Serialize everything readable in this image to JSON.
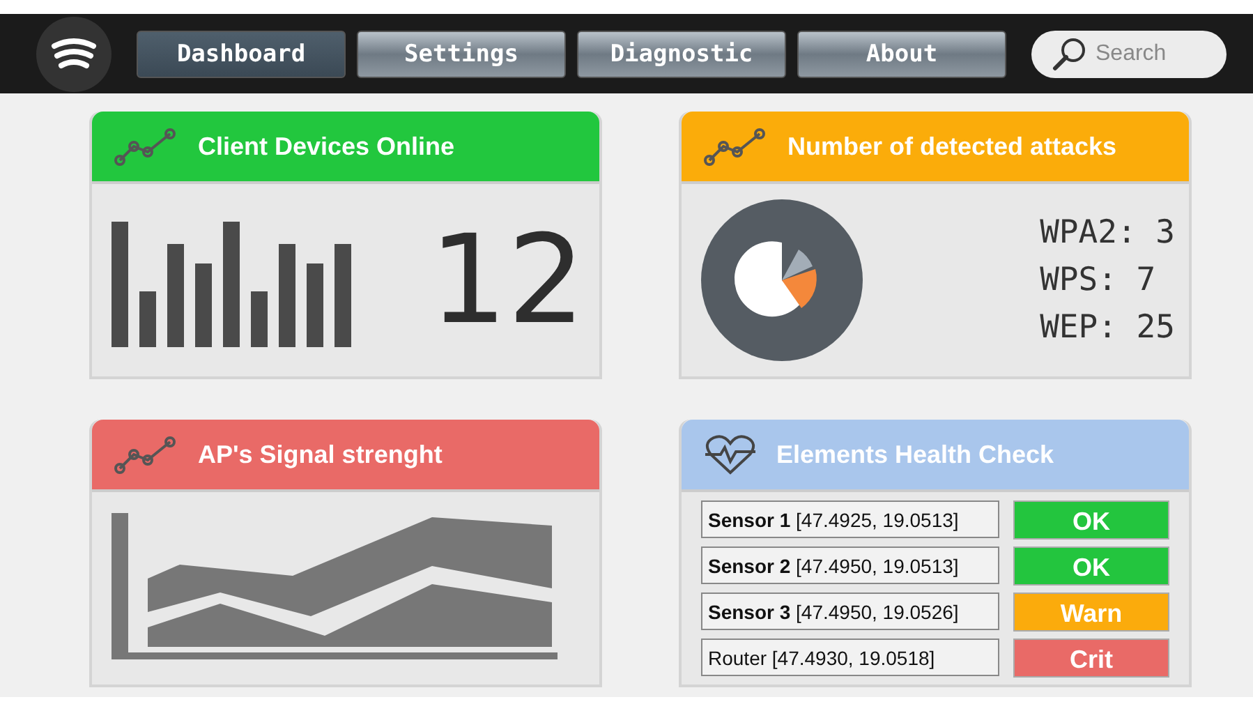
{
  "nav": {
    "tabs": [
      {
        "label": "Dashboard",
        "selected": true
      },
      {
        "label": "Settings",
        "selected": false
      },
      {
        "label": "Diagnostic",
        "selected": false
      },
      {
        "label": "About",
        "selected": false
      }
    ],
    "search": {
      "placeholder": "Search"
    }
  },
  "cards": [
    {
      "kind": "devices",
      "title": "Client Devices Online",
      "color": "#22c73e",
      "count": "12"
    },
    {
      "kind": "attacks",
      "title": "Number of detected attacks",
      "color": "#fbac0a",
      "lines": [
        "WPA2: 3",
        "WPS: 7",
        "WEP: 25"
      ]
    },
    {
      "kind": "signal",
      "title": "AP's Signal strenght",
      "color": "#e96a67"
    },
    {
      "kind": "health",
      "title": "Elements Health Check",
      "color": "#a9c6ec",
      "rows": [
        {
          "name": "**Sensor 1** [47.4925, 19.0513]",
          "status": "OK",
          "color": "#23c53e"
        },
        {
          "name": "**Sensor 2** [47.4950, 19.0513]",
          "status": "OK",
          "color": "#23c53e"
        },
        {
          "name": "**Sensor 3** [47.4950, 19.0526]",
          "status": "Warn",
          "color": "#fbab0c"
        },
        {
          "name": "Router [47.4930, 19.0518]",
          "status": "Crit",
          "color": "#e96a67"
        }
      ]
    }
  ]
}
